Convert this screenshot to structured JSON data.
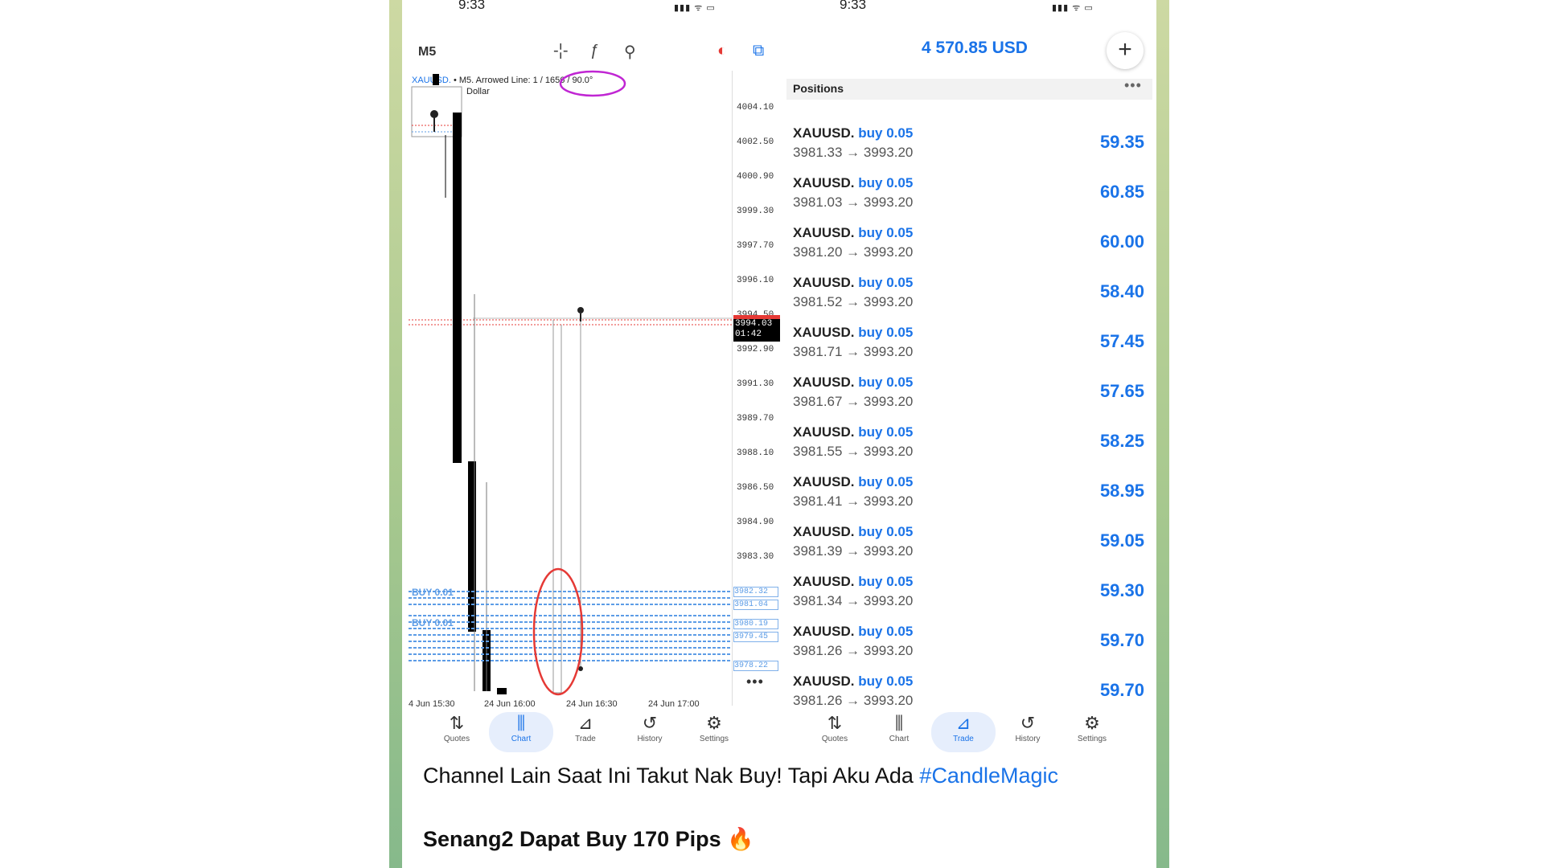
{
  "left_screen": {
    "status_time": "9:33",
    "status_icons": "▮▮▮ ᯤ ▭",
    "timeframe": "M5",
    "toolbar_icons": [
      "crosshair-icon",
      "function-icon",
      "objects-icon",
      "trade-circle-icon",
      "switch-icon"
    ],
    "toolbar_glyphs": [
      "-¦-",
      "ƒ",
      "⚲",
      "◐",
      "⧉"
    ],
    "chart_title_symbol": "XAUUSD.",
    "chart_title_rest": "• M5. Arrowed Line: 1 / 1656 / 90.0°",
    "chart_subtitle": "Dollar",
    "price_ticks": [
      "4004.10",
      "4002.50",
      "4000.90",
      "3999.30",
      "3997.70",
      "3996.10",
      "3994.50",
      "3992.90",
      "3991.30",
      "3989.70",
      "3988.10",
      "3986.50",
      "3984.90",
      "3983.30"
    ],
    "current_price": "3994.03",
    "current_timer": "01:42",
    "buy_labels": [
      "BUY 0.01",
      "BUY 0.01"
    ],
    "buy_price_tags": [
      "3982.32",
      "3981.04",
      "3980.19",
      "3979.45",
      "3978.22"
    ],
    "time_ticks": [
      "4 Jun 15:30",
      "24 Jun 16:00",
      "24 Jun 16:30",
      "24 Jun 17:00"
    ],
    "more_label": "•••",
    "tabs": [
      {
        "label": "Quotes",
        "icon": "quotes-icon",
        "glyph": "⇅"
      },
      {
        "label": "Chart",
        "icon": "chart-icon",
        "glyph": "⫼"
      },
      {
        "label": "Trade",
        "icon": "trade-icon",
        "glyph": "⊿"
      },
      {
        "label": "History",
        "icon": "history-icon",
        "glyph": "↺"
      },
      {
        "label": "Settings",
        "icon": "settings-icon",
        "glyph": "⚙"
      }
    ],
    "active_tab": "Chart"
  },
  "right_screen": {
    "status_time": "9:33",
    "status_icons": "▮▮▮ ᯤ ▭",
    "balance": "4 570.85 USD",
    "plus_label": "+",
    "positions_title": "Positions",
    "positions_more": "•••",
    "positions": [
      {
        "symbol": "XAUUSD.",
        "side": "buy 0.05",
        "route": "3981.33 → 3993.20",
        "profit": "59.35"
      },
      {
        "symbol": "XAUUSD.",
        "side": "buy 0.05",
        "route": "3981.03 → 3993.20",
        "profit": "60.85"
      },
      {
        "symbol": "XAUUSD.",
        "side": "buy 0.05",
        "route": "3981.20 → 3993.20",
        "profit": "60.00"
      },
      {
        "symbol": "XAUUSD.",
        "side": "buy 0.05",
        "route": "3981.52 → 3993.20",
        "profit": "58.40"
      },
      {
        "symbol": "XAUUSD.",
        "side": "buy 0.05",
        "route": "3981.71 → 3993.20",
        "profit": "57.45"
      },
      {
        "symbol": "XAUUSD.",
        "side": "buy 0.05",
        "route": "3981.67 → 3993.20",
        "profit": "57.65"
      },
      {
        "symbol": "XAUUSD.",
        "side": "buy 0.05",
        "route": "3981.55 → 3993.20",
        "profit": "58.25"
      },
      {
        "symbol": "XAUUSD.",
        "side": "buy 0.05",
        "route": "3981.41 → 3993.20",
        "profit": "58.95"
      },
      {
        "symbol": "XAUUSD.",
        "side": "buy 0.05",
        "route": "3981.39 → 3993.20",
        "profit": "59.05"
      },
      {
        "symbol": "XAUUSD.",
        "side": "buy 0.05",
        "route": "3981.34 → 3993.20",
        "profit": "59.30"
      },
      {
        "symbol": "XAUUSD.",
        "side": "buy 0.05",
        "route": "3981.26 → 3993.20",
        "profit": "59.70"
      },
      {
        "symbol": "XAUUSD.",
        "side": "buy 0.05",
        "route": "3981.26 → 3993.20",
        "profit": "59.70"
      }
    ],
    "tabs": [
      {
        "label": "Quotes",
        "icon": "quotes-icon",
        "glyph": "⇅"
      },
      {
        "label": "Chart",
        "icon": "chart-icon",
        "glyph": "⫼"
      },
      {
        "label": "Trade",
        "icon": "trade-icon",
        "glyph": "⊿"
      },
      {
        "label": "History",
        "icon": "history-icon",
        "glyph": "↺"
      },
      {
        "label": "Settings",
        "icon": "settings-icon",
        "glyph": "⚙"
      }
    ],
    "active_tab": "Trade"
  },
  "caption": {
    "line1_text": "Channel Lain Saat Ini Takut Nak Buy! Tapi Aku Ada ",
    "line1_hashtag": "#CandleMagic",
    "line2_text": "Senang2 Dapat Buy 170 Pips ",
    "line2_emoji": "🔥"
  },
  "colors": {
    "accent_blue": "#1a73e8",
    "candle": "#000000",
    "annotation_red": "#e53935",
    "annotation_magenta": "#c026d3",
    "buy_line": "#5c9ce6"
  }
}
